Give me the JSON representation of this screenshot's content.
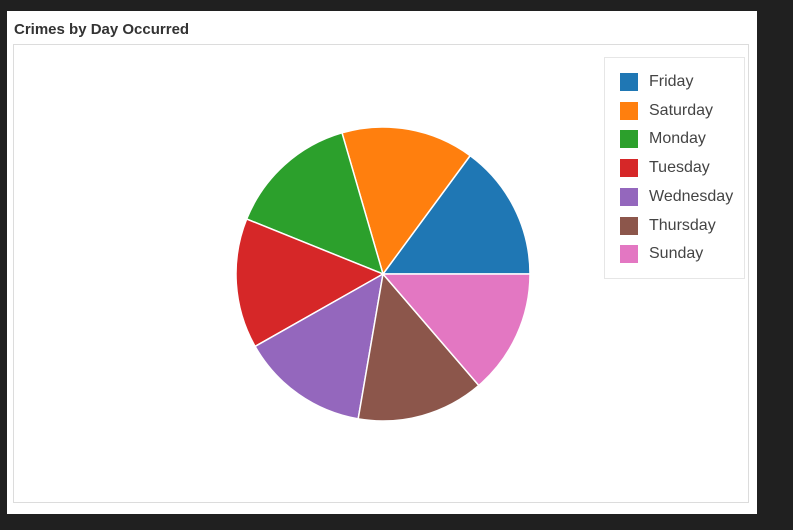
{
  "panel": {
    "title": "Crimes by Day Occurred"
  },
  "chart_data": {
    "type": "pie",
    "title": "Crimes by Day Occurred",
    "legend_position": "top-right",
    "categories": [
      "Friday",
      "Saturday",
      "Monday",
      "Tuesday",
      "Wednesday",
      "Thursday",
      "Sunday"
    ],
    "values": [
      14.9,
      14.6,
      14.4,
      14.3,
      14.1,
      14.0,
      13.7
    ],
    "unit": "percent",
    "colors": [
      "#1f77b4",
      "#ff7f0e",
      "#2ca02c",
      "#d62728",
      "#9467bd",
      "#8c564b",
      "#e377c2"
    ]
  }
}
